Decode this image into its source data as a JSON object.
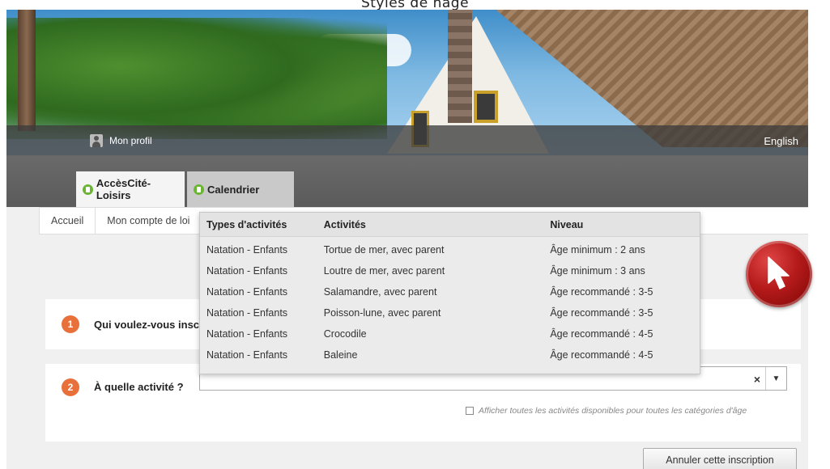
{
  "caption": "Styles de nage",
  "header": {
    "profile_label": "Mon profil",
    "language_link": "English"
  },
  "tabs": [
    {
      "label": "AccèsCité-Loisirs",
      "active": true
    },
    {
      "label": "Calendrier",
      "active": false
    }
  ],
  "nav": {
    "items": [
      "Accueil",
      "Mon compte de loi"
    ]
  },
  "steps": {
    "step1": {
      "number": "1",
      "label": "Qui voulez-vous insc"
    },
    "step2": {
      "number": "2",
      "label": "À quelle activité ?"
    }
  },
  "activity_select": {
    "value": "",
    "clear_symbol": "×",
    "caret_symbol": "▼"
  },
  "show_all_checkbox": {
    "label": "Afficher toutes les activités disponibles pour toutes les catégories d'âge",
    "checked": false
  },
  "cancel_button": "Annuler cette inscription",
  "dropdown": {
    "headers": [
      "Types d'activités",
      "Activités",
      "Niveau"
    ],
    "rows": [
      [
        "Natation - Enfants",
        "Tortue de mer, avec parent",
        "Âge minimum : 2 ans"
      ],
      [
        "Natation - Enfants",
        "Loutre de mer, avec parent",
        "Âge minimum : 3 ans"
      ],
      [
        "Natation - Enfants",
        "Salamandre, avec parent",
        "Âge recommandé : 3-5"
      ],
      [
        "Natation - Enfants",
        "Poisson-lune, avec parent",
        "Âge recommandé : 3-5"
      ],
      [
        "Natation - Enfants",
        "Crocodile",
        "Âge recommandé : 4-5"
      ],
      [
        "Natation - Enfants",
        "Baleine",
        "Âge recommandé : 4-5"
      ]
    ]
  },
  "colors": {
    "step_badge": "#e8703a",
    "tab_icon": "#6bb535",
    "cursor_badge": "#b51a1a"
  }
}
